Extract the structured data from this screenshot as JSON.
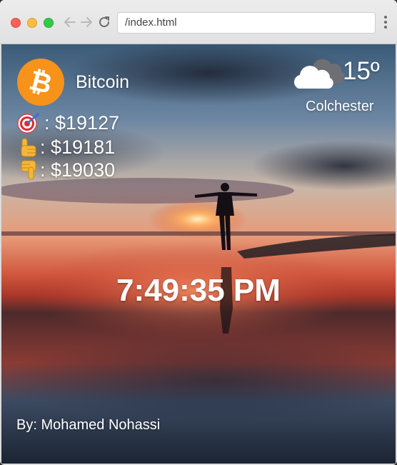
{
  "browser": {
    "url": "/index.html"
  },
  "crypto": {
    "name": "Bitcoin",
    "logo_icon": "bitcoin-logo-icon",
    "current_icon": "target-icon",
    "high_icon": "point-up-icon",
    "low_icon": "point-down-icon",
    "current": ": $19127",
    "high": ": $19181",
    "low": ": $19030",
    "brand_color": "#f7931a"
  },
  "weather": {
    "icon": "cloud-icon",
    "temperature": "15º",
    "city": "Colchester"
  },
  "clock": {
    "time": "7:49:35 PM"
  },
  "footer": {
    "credit": "By: Mohamed Nohassi"
  }
}
